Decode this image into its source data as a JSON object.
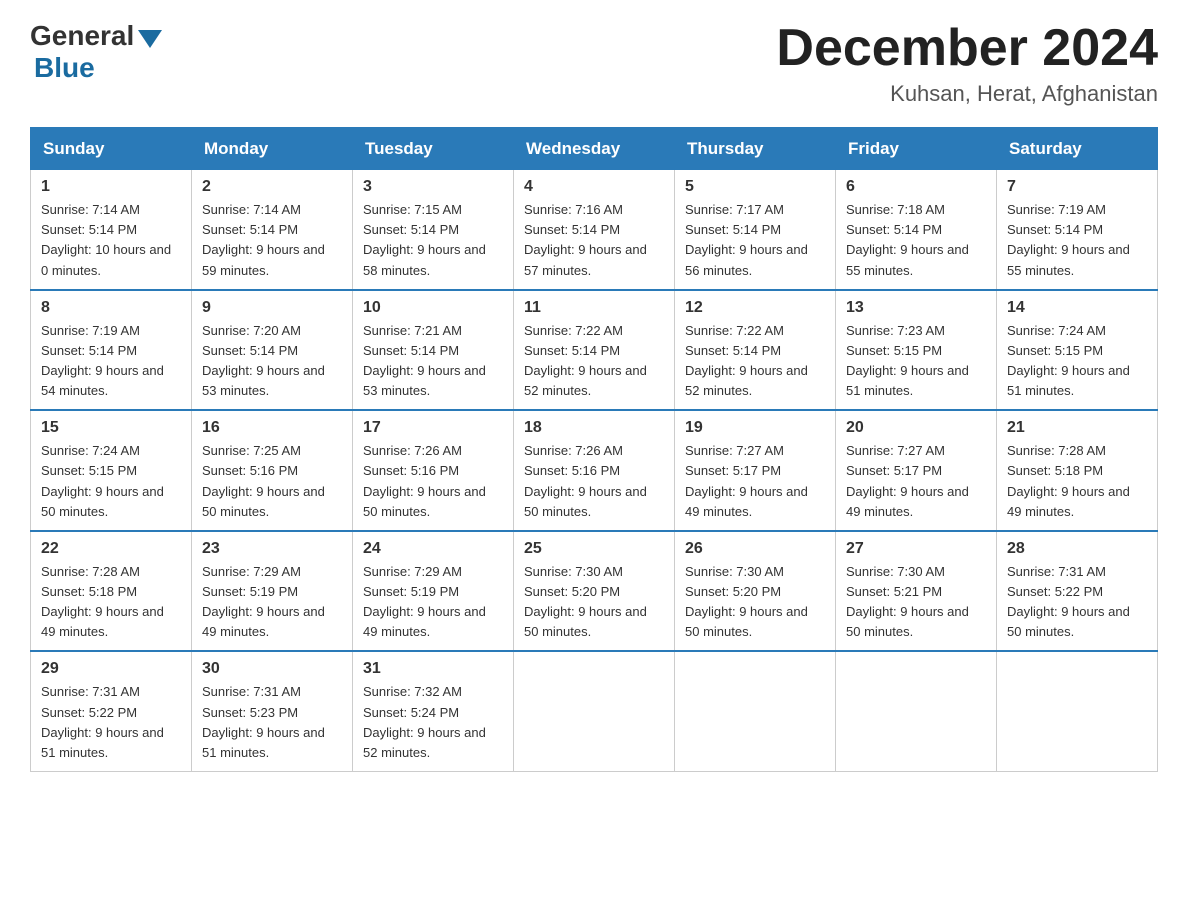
{
  "logo": {
    "general": "General",
    "blue": "Blue"
  },
  "title": "December 2024",
  "location": "Kuhsan, Herat, Afghanistan",
  "headers": [
    "Sunday",
    "Monday",
    "Tuesday",
    "Wednesday",
    "Thursday",
    "Friday",
    "Saturday"
  ],
  "weeks": [
    [
      {
        "day": "1",
        "sunrise": "7:14 AM",
        "sunset": "5:14 PM",
        "daylight": "10 hours and 0 minutes."
      },
      {
        "day": "2",
        "sunrise": "7:14 AM",
        "sunset": "5:14 PM",
        "daylight": "9 hours and 59 minutes."
      },
      {
        "day": "3",
        "sunrise": "7:15 AM",
        "sunset": "5:14 PM",
        "daylight": "9 hours and 58 minutes."
      },
      {
        "day": "4",
        "sunrise": "7:16 AM",
        "sunset": "5:14 PM",
        "daylight": "9 hours and 57 minutes."
      },
      {
        "day": "5",
        "sunrise": "7:17 AM",
        "sunset": "5:14 PM",
        "daylight": "9 hours and 56 minutes."
      },
      {
        "day": "6",
        "sunrise": "7:18 AM",
        "sunset": "5:14 PM",
        "daylight": "9 hours and 55 minutes."
      },
      {
        "day": "7",
        "sunrise": "7:19 AM",
        "sunset": "5:14 PM",
        "daylight": "9 hours and 55 minutes."
      }
    ],
    [
      {
        "day": "8",
        "sunrise": "7:19 AM",
        "sunset": "5:14 PM",
        "daylight": "9 hours and 54 minutes."
      },
      {
        "day": "9",
        "sunrise": "7:20 AM",
        "sunset": "5:14 PM",
        "daylight": "9 hours and 53 minutes."
      },
      {
        "day": "10",
        "sunrise": "7:21 AM",
        "sunset": "5:14 PM",
        "daylight": "9 hours and 53 minutes."
      },
      {
        "day": "11",
        "sunrise": "7:22 AM",
        "sunset": "5:14 PM",
        "daylight": "9 hours and 52 minutes."
      },
      {
        "day": "12",
        "sunrise": "7:22 AM",
        "sunset": "5:14 PM",
        "daylight": "9 hours and 52 minutes."
      },
      {
        "day": "13",
        "sunrise": "7:23 AM",
        "sunset": "5:15 PM",
        "daylight": "9 hours and 51 minutes."
      },
      {
        "day": "14",
        "sunrise": "7:24 AM",
        "sunset": "5:15 PM",
        "daylight": "9 hours and 51 minutes."
      }
    ],
    [
      {
        "day": "15",
        "sunrise": "7:24 AM",
        "sunset": "5:15 PM",
        "daylight": "9 hours and 50 minutes."
      },
      {
        "day": "16",
        "sunrise": "7:25 AM",
        "sunset": "5:16 PM",
        "daylight": "9 hours and 50 minutes."
      },
      {
        "day": "17",
        "sunrise": "7:26 AM",
        "sunset": "5:16 PM",
        "daylight": "9 hours and 50 minutes."
      },
      {
        "day": "18",
        "sunrise": "7:26 AM",
        "sunset": "5:16 PM",
        "daylight": "9 hours and 50 minutes."
      },
      {
        "day": "19",
        "sunrise": "7:27 AM",
        "sunset": "5:17 PM",
        "daylight": "9 hours and 49 minutes."
      },
      {
        "day": "20",
        "sunrise": "7:27 AM",
        "sunset": "5:17 PM",
        "daylight": "9 hours and 49 minutes."
      },
      {
        "day": "21",
        "sunrise": "7:28 AM",
        "sunset": "5:18 PM",
        "daylight": "9 hours and 49 minutes."
      }
    ],
    [
      {
        "day": "22",
        "sunrise": "7:28 AM",
        "sunset": "5:18 PM",
        "daylight": "9 hours and 49 minutes."
      },
      {
        "day": "23",
        "sunrise": "7:29 AM",
        "sunset": "5:19 PM",
        "daylight": "9 hours and 49 minutes."
      },
      {
        "day": "24",
        "sunrise": "7:29 AM",
        "sunset": "5:19 PM",
        "daylight": "9 hours and 49 minutes."
      },
      {
        "day": "25",
        "sunrise": "7:30 AM",
        "sunset": "5:20 PM",
        "daylight": "9 hours and 50 minutes."
      },
      {
        "day": "26",
        "sunrise": "7:30 AM",
        "sunset": "5:20 PM",
        "daylight": "9 hours and 50 minutes."
      },
      {
        "day": "27",
        "sunrise": "7:30 AM",
        "sunset": "5:21 PM",
        "daylight": "9 hours and 50 minutes."
      },
      {
        "day": "28",
        "sunrise": "7:31 AM",
        "sunset": "5:22 PM",
        "daylight": "9 hours and 50 minutes."
      }
    ],
    [
      {
        "day": "29",
        "sunrise": "7:31 AM",
        "sunset": "5:22 PM",
        "daylight": "9 hours and 51 minutes."
      },
      {
        "day": "30",
        "sunrise": "7:31 AM",
        "sunset": "5:23 PM",
        "daylight": "9 hours and 51 minutes."
      },
      {
        "day": "31",
        "sunrise": "7:32 AM",
        "sunset": "5:24 PM",
        "daylight": "9 hours and 52 minutes."
      },
      null,
      null,
      null,
      null
    ]
  ]
}
